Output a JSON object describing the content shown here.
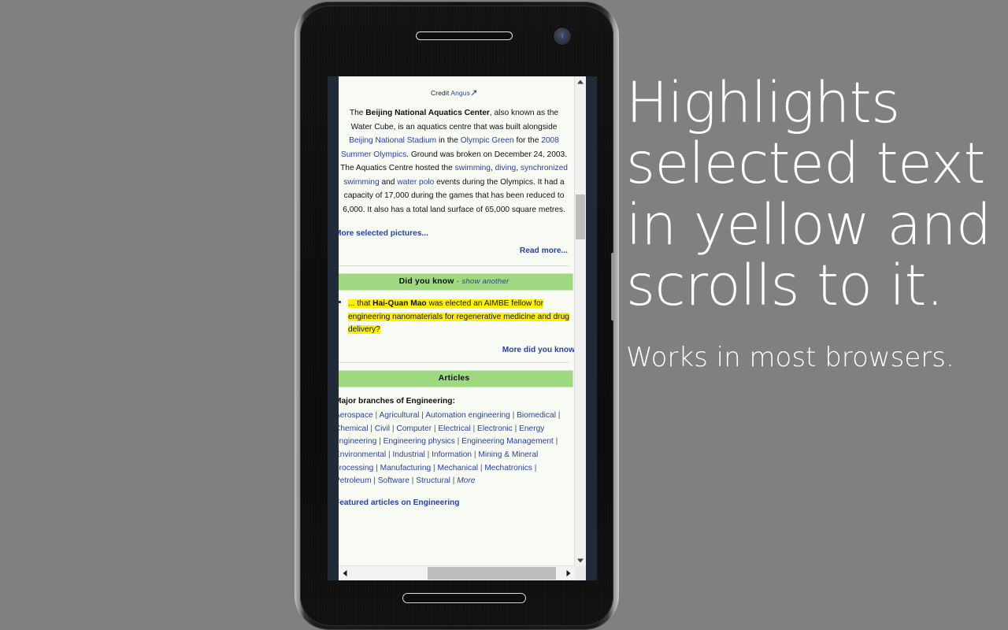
{
  "background_color": "#808080",
  "caption": {
    "headline": "Highlights selected text in yellow and scrolls to it.",
    "subline": "Works in most browsers."
  },
  "phone": {
    "earpiece_label": "earpiece-speaker",
    "camera_label": "front-camera",
    "bottom_speaker_label": "bottom-speaker",
    "volume_rocker_label": "volume-rocker"
  },
  "page": {
    "credit": {
      "label": "Credit",
      "author": "Angus",
      "icon": "external-link-icon"
    },
    "lead_paragraph": {
      "segments": [
        {
          "text": "The ",
          "style": "plain"
        },
        {
          "text": "Beijing National Aquatics Center",
          "style": "bold"
        },
        {
          "text": ", also known as the Water Cube, is an aquatics centre that was built alongside ",
          "style": "plain"
        },
        {
          "text": "Beijing National Stadium",
          "style": "link"
        },
        {
          "text": " in the ",
          "style": "plain"
        },
        {
          "text": "Olympic Green",
          "style": "link"
        },
        {
          "text": " for the ",
          "style": "plain"
        },
        {
          "text": "2008 Summer Olympics",
          "style": "link"
        },
        {
          "text": ". Ground was broken on December 24, 2003. The Aquatics Centre hosted the ",
          "style": "plain"
        },
        {
          "text": "swimming",
          "style": "link"
        },
        {
          "text": ", ",
          "style": "plain"
        },
        {
          "text": "diving",
          "style": "link"
        },
        {
          "text": ", ",
          "style": "plain"
        },
        {
          "text": "synchronized swimming",
          "style": "link"
        },
        {
          "text": " and ",
          "style": "plain"
        },
        {
          "text": "water polo",
          "style": "link"
        },
        {
          "text": " events during the Olympics. It had a capacity of 17,000 during the games that has been reduced to 6,000. It also has a total land surface of 65,000 square metres.",
          "style": "plain"
        }
      ],
      "plain_text": "The Beijing National Aquatics Center, also known as the Water Cube, is an aquatics centre that was built alongside Beijing National Stadium in the Olympic Green for the 2008 Summer Olympics. Ground was broken on December 24, 2003. The Aquatics Centre hosted the swimming, diving, synchronized swimming and water polo events during the Olympics. It had a capacity of 17,000 during the games that has been reduced to 6,000. It also has a total land surface of 65,000 square metres."
    },
    "more_selected_pictures": "More selected pictures...",
    "read_more": "Read more...",
    "did_you_know": {
      "heading": "Did you know",
      "separator": " · ",
      "show_another": "show another",
      "item_prefix": "... that ",
      "item_bold": "Hai-Quan Mao",
      "item_rest": " was elected an AIMBE fellow for engineering nanomaterials for regenerative medicine and drug delivery?",
      "highlight_color": "#fff000",
      "more_link": "More did you know"
    },
    "articles": {
      "heading": "Articles",
      "branches_label": "Major branches of Engineering:",
      "branches": [
        "Aerospace",
        "Agricultural",
        "Automation engineering",
        "Biomedical",
        "Chemical",
        "Civil",
        "Computer",
        "Electrical",
        "Electronic",
        "Energy engineering",
        "Engineering physics",
        "Engineering Management",
        "Environmental",
        "Industrial",
        "Information",
        "Mining & Mineral processing",
        "Manufacturing",
        "Mechanical",
        "Mechatronics",
        "Petroleum",
        "Software",
        "Structural"
      ],
      "branches_more": "More",
      "featured": "Featured articles on Engineering"
    },
    "section_header_color": "#9ed881",
    "link_color": "#2a3fa8"
  },
  "scrollbars": {
    "v_up": "scroll-up-arrow",
    "v_down": "scroll-down-arrow",
    "h_left": "scroll-left-arrow",
    "h_right": "scroll-right-arrow"
  }
}
